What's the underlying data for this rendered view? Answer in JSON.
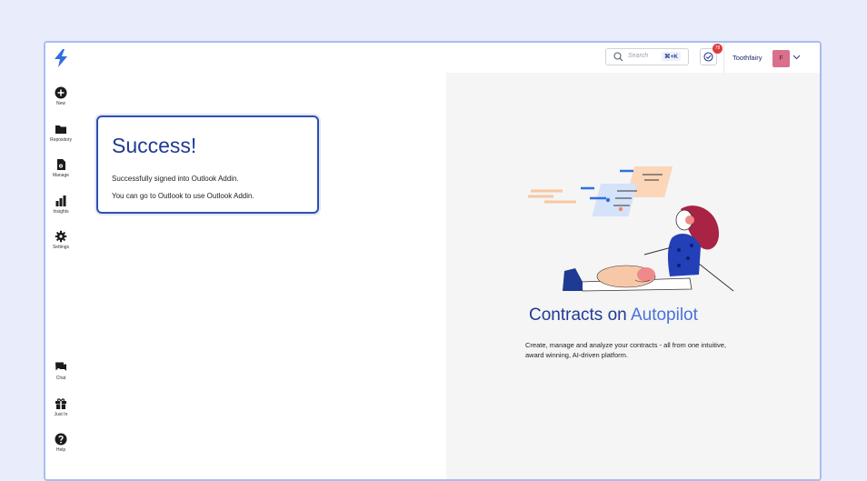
{
  "sidebar": {
    "items": [
      {
        "label": "New",
        "icon": "plus-circle-icon"
      },
      {
        "label": "Repository",
        "icon": "folder-icon"
      },
      {
        "label": "Manage",
        "icon": "manage-icon"
      },
      {
        "label": "Insights",
        "icon": "bar-chart-icon"
      },
      {
        "label": "Settings",
        "icon": "gear-icon"
      }
    ],
    "bottom_items": [
      {
        "label": "Chat",
        "icon": "chat-icon"
      },
      {
        "label": "Just In",
        "icon": "gift-icon"
      },
      {
        "label": "Help",
        "icon": "help-icon"
      }
    ]
  },
  "header": {
    "search_placeholder": "Search",
    "search_shortcut": "⌘+K",
    "task_badge_count": "78",
    "org_name": "Toothfairy",
    "avatar_initial": "F"
  },
  "success_card": {
    "title": "Success!",
    "line1": "Successfully signed into Outlook Addin.",
    "line2": "You can go to Outlook to use Outlook Addin."
  },
  "promo": {
    "headline_main": "Contracts on ",
    "headline_accent": "Autopilot",
    "description": "Create, manage and analyze your contracts - all from one intuitive, award winning, AI-driven platform."
  },
  "colors": {
    "brand": "#1f3a93",
    "accent": "#4a72d9",
    "badge": "#e03a3a",
    "background": "#e8ecfb"
  }
}
